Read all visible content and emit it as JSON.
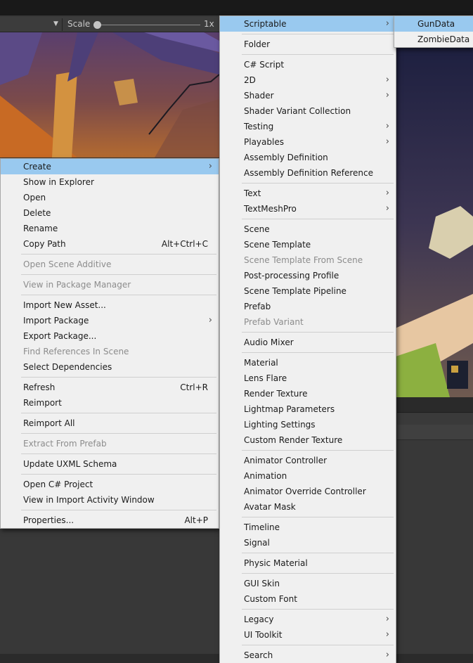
{
  "toolbar": {
    "scale_label": "Scale",
    "scale_value": "1x"
  },
  "context_menu": {
    "items": [
      {
        "type": "item",
        "label": "Create",
        "highlight": true,
        "submenu": true
      },
      {
        "type": "item",
        "label": "Show in Explorer"
      },
      {
        "type": "item",
        "label": "Open"
      },
      {
        "type": "item",
        "label": "Delete"
      },
      {
        "type": "item",
        "label": "Rename"
      },
      {
        "type": "item",
        "label": "Copy Path",
        "shortcut": "Alt+Ctrl+C"
      },
      {
        "type": "sep"
      },
      {
        "type": "item",
        "label": "Open Scene Additive",
        "disabled": true
      },
      {
        "type": "sep"
      },
      {
        "type": "item",
        "label": "View in Package Manager",
        "disabled": true
      },
      {
        "type": "sep"
      },
      {
        "type": "item",
        "label": "Import New Asset..."
      },
      {
        "type": "item",
        "label": "Import Package",
        "submenu": true
      },
      {
        "type": "item",
        "label": "Export Package..."
      },
      {
        "type": "item",
        "label": "Find References In Scene",
        "disabled": true
      },
      {
        "type": "item",
        "label": "Select Dependencies"
      },
      {
        "type": "sep"
      },
      {
        "type": "item",
        "label": "Refresh",
        "shortcut": "Ctrl+R"
      },
      {
        "type": "item",
        "label": "Reimport"
      },
      {
        "type": "sep"
      },
      {
        "type": "item",
        "label": "Reimport All"
      },
      {
        "type": "sep"
      },
      {
        "type": "item",
        "label": "Extract From Prefab",
        "disabled": true
      },
      {
        "type": "sep"
      },
      {
        "type": "item",
        "label": "Update UXML Schema"
      },
      {
        "type": "sep"
      },
      {
        "type": "item",
        "label": "Open C# Project"
      },
      {
        "type": "item",
        "label": "View in Import Activity Window"
      },
      {
        "type": "sep"
      },
      {
        "type": "item",
        "label": "Properties...",
        "shortcut": "Alt+P"
      }
    ]
  },
  "create_menu": {
    "items": [
      {
        "type": "item",
        "label": "Scriptable",
        "highlight": true,
        "submenu": true
      },
      {
        "type": "sep"
      },
      {
        "type": "item",
        "label": "Folder"
      },
      {
        "type": "sep"
      },
      {
        "type": "item",
        "label": "C# Script"
      },
      {
        "type": "item",
        "label": "2D",
        "submenu": true
      },
      {
        "type": "item",
        "label": "Shader",
        "submenu": true
      },
      {
        "type": "item",
        "label": "Shader Variant Collection"
      },
      {
        "type": "item",
        "label": "Testing",
        "submenu": true
      },
      {
        "type": "item",
        "label": "Playables",
        "submenu": true
      },
      {
        "type": "item",
        "label": "Assembly Definition"
      },
      {
        "type": "item",
        "label": "Assembly Definition Reference"
      },
      {
        "type": "sep"
      },
      {
        "type": "item",
        "label": "Text",
        "submenu": true
      },
      {
        "type": "item",
        "label": "TextMeshPro",
        "submenu": true
      },
      {
        "type": "sep"
      },
      {
        "type": "item",
        "label": "Scene"
      },
      {
        "type": "item",
        "label": "Scene Template"
      },
      {
        "type": "item",
        "label": "Scene Template From Scene",
        "disabled": true
      },
      {
        "type": "item",
        "label": "Post-processing Profile"
      },
      {
        "type": "item",
        "label": "Scene Template Pipeline"
      },
      {
        "type": "item",
        "label": "Prefab"
      },
      {
        "type": "item",
        "label": "Prefab Variant",
        "disabled": true
      },
      {
        "type": "sep"
      },
      {
        "type": "item",
        "label": "Audio Mixer"
      },
      {
        "type": "sep"
      },
      {
        "type": "item",
        "label": "Material"
      },
      {
        "type": "item",
        "label": "Lens Flare"
      },
      {
        "type": "item",
        "label": "Render Texture"
      },
      {
        "type": "item",
        "label": "Lightmap Parameters"
      },
      {
        "type": "item",
        "label": "Lighting Settings"
      },
      {
        "type": "item",
        "label": "Custom Render Texture"
      },
      {
        "type": "sep"
      },
      {
        "type": "item",
        "label": "Animator Controller"
      },
      {
        "type": "item",
        "label": "Animation"
      },
      {
        "type": "item",
        "label": "Animator Override Controller"
      },
      {
        "type": "item",
        "label": "Avatar Mask"
      },
      {
        "type": "sep"
      },
      {
        "type": "item",
        "label": "Timeline"
      },
      {
        "type": "item",
        "label": "Signal"
      },
      {
        "type": "sep"
      },
      {
        "type": "item",
        "label": "Physic Material"
      },
      {
        "type": "sep"
      },
      {
        "type": "item",
        "label": "GUI Skin"
      },
      {
        "type": "item",
        "label": "Custom Font"
      },
      {
        "type": "sep"
      },
      {
        "type": "item",
        "label": "Legacy",
        "submenu": true
      },
      {
        "type": "item",
        "label": "UI Toolkit",
        "submenu": true
      },
      {
        "type": "sep"
      },
      {
        "type": "item",
        "label": "Search",
        "submenu": true
      }
    ]
  },
  "scriptable_menu": {
    "items": [
      {
        "type": "item",
        "label": "GunData",
        "highlight": true
      },
      {
        "type": "item",
        "label": "ZombieData"
      }
    ]
  }
}
